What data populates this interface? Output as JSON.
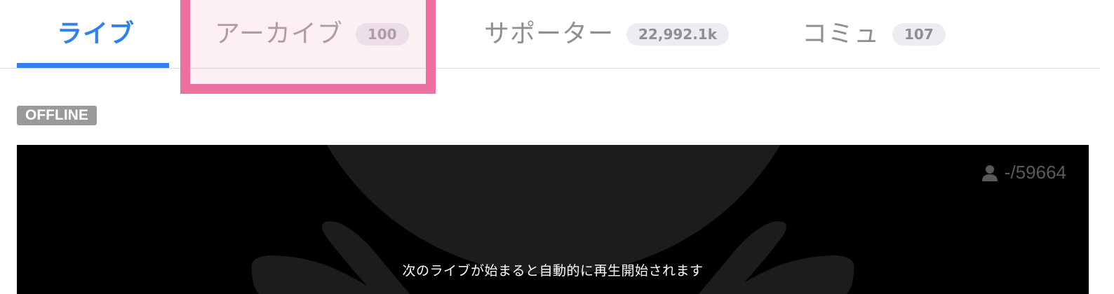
{
  "tabs": [
    {
      "label": "ライブ",
      "count": null,
      "active": true
    },
    {
      "label": "アーカイブ",
      "count": "100",
      "active": false
    },
    {
      "label": "サポーター",
      "count": "22,992.1k",
      "active": false
    },
    {
      "label": "コミュ",
      "count": "107",
      "active": false
    }
  ],
  "status_badge": "OFFLINE",
  "player": {
    "viewer_count": "-/59664",
    "message": "次のライブが始まると自動的に再生開始されます"
  },
  "colors": {
    "accent": "#2e82f0",
    "highlight": "#ee6fa0",
    "badge": "#9a9a9a",
    "player_bg": "#000000"
  },
  "icons": {
    "viewer": "person-icon"
  }
}
